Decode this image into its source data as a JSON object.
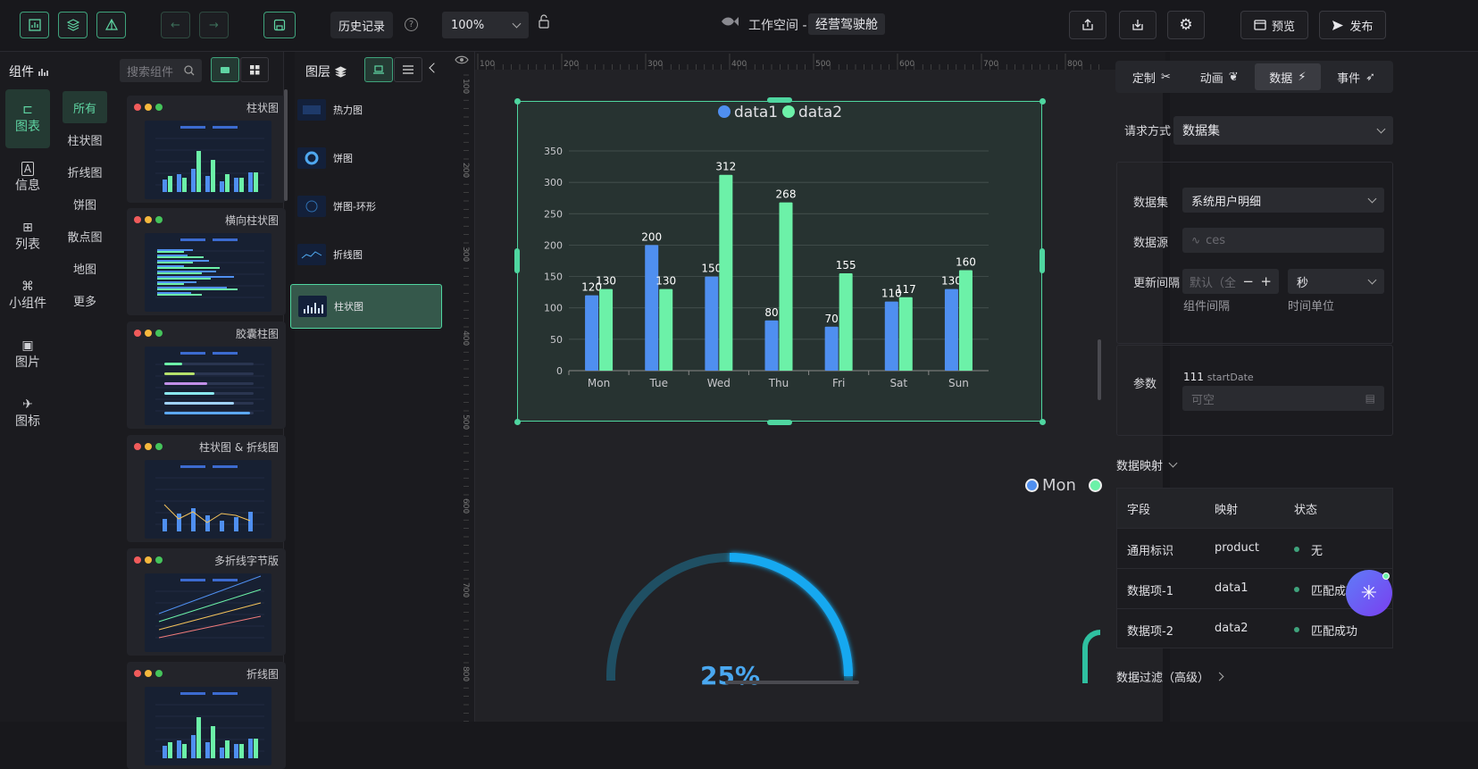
{
  "toolbar": {
    "history_label": "历史记录",
    "zoom": "100%",
    "workspace_prefix": "工作空间 -",
    "workspace_name": "经营驾驶舱",
    "preview_label": "预览",
    "publish_label": "发布"
  },
  "left_panel": {
    "title": "组件",
    "search_placeholder": "搜索组件"
  },
  "nav": [
    {
      "label": "图表"
    },
    {
      "label": "信息"
    },
    {
      "label": "列表"
    },
    {
      "label": "小组件"
    },
    {
      "label": "图片"
    },
    {
      "label": "图标"
    }
  ],
  "sub_nav": [
    {
      "label": "所有"
    },
    {
      "label": "柱状图"
    },
    {
      "label": "折线图"
    },
    {
      "label": "饼图"
    },
    {
      "label": "散点图"
    },
    {
      "label": "地图"
    },
    {
      "label": "更多"
    }
  ],
  "components": [
    {
      "label": "柱状图"
    },
    {
      "label": "横向柱状图"
    },
    {
      "label": "胶囊柱图"
    },
    {
      "label": "柱状图 & 折线图"
    },
    {
      "label": "多折线字节版"
    },
    {
      "label": "折线图"
    }
  ],
  "layers": {
    "title": "图层",
    "items": [
      {
        "label": "热力图"
      },
      {
        "label": "饼图"
      },
      {
        "label": "饼图-环形"
      },
      {
        "label": "折线图"
      },
      {
        "label": "柱状图"
      }
    ]
  },
  "ruler": {
    "h": [
      "100",
      "200",
      "300",
      "400",
      "500",
      "600",
      "700",
      "800"
    ],
    "v": [
      "100",
      "200",
      "300",
      "400",
      "500",
      "600",
      "700",
      "800"
    ]
  },
  "chart_data": {
    "type": "bar",
    "categories": [
      "Mon",
      "Tue",
      "Wed",
      "Thu",
      "Fri",
      "Sat",
      "Sun"
    ],
    "series": [
      {
        "name": "data1",
        "values": [
          120,
          200,
          150,
          80,
          70,
          110,
          130
        ]
      },
      {
        "name": "data2",
        "values": [
          130,
          130,
          312,
          268,
          155,
          117,
          160
        ]
      }
    ],
    "ylim": [
      0,
      350
    ],
    "yticks": [
      "0",
      "50",
      "100",
      "150",
      "200",
      "250",
      "300",
      "350"
    ],
    "colors": [
      "#4f8ff0",
      "#6cf1a8"
    ],
    "legend": "top-center",
    "grid": true
  },
  "canvas_extra": {
    "legend_item": "Mon",
    "gauge_label": "25%"
  },
  "right_panel": {
    "tabs": [
      {
        "label": "定制"
      },
      {
        "label": "动画"
      },
      {
        "label": "数据"
      },
      {
        "label": "事件"
      }
    ],
    "request_label": "请求方式",
    "request_value": "数据集",
    "dataset_label": "数据集",
    "dataset_value": "系统用户明细",
    "datasource_label": "数据源",
    "datasource_placeholder": "ces",
    "interval_label": "更新间隔",
    "interval_placeholder": "默认（全",
    "unit_value": "秒",
    "interval_hint": "组件间隔",
    "unit_hint": "时间单位",
    "param_label": "参数",
    "param_name": "111",
    "param_key": "startDate",
    "param_placeholder": "可空",
    "mapping_title": "数据映射",
    "mapping_headers": [
      "字段",
      "映射",
      "状态"
    ],
    "mapping_rows": [
      {
        "field": "通用标识",
        "map": "product",
        "status": "无"
      },
      {
        "field": "数据项-1",
        "map": "data1",
        "status": "匹配成功"
      },
      {
        "field": "数据项-2",
        "map": "data2",
        "status": "匹配成功"
      }
    ],
    "filter_title": "数据过滤（高级）"
  }
}
